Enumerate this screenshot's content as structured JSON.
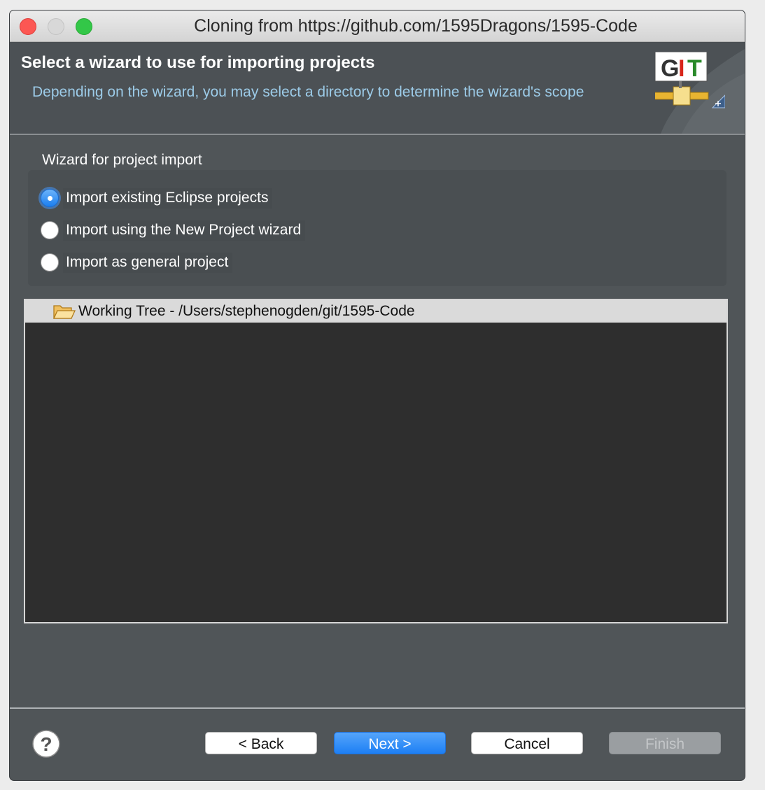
{
  "window": {
    "title": "Cloning from https://github.com/1595Dragons/1595-Code"
  },
  "header": {
    "title": "Select a wizard to use for importing projects",
    "description": "Depending on the wizard, you may select a directory to determine the wizard's scope",
    "logo_text": "GIT"
  },
  "wizard_group": {
    "label": "Wizard for project import",
    "options": [
      {
        "label": "Import existing Eclipse projects",
        "selected": true
      },
      {
        "label": "Import using the New Project wizard",
        "selected": false
      },
      {
        "label": "Import as general project",
        "selected": false
      }
    ]
  },
  "tree": {
    "items": [
      {
        "label": "Working Tree - /Users/stephenogden/git/1595-Code",
        "icon": "folder-open-icon"
      }
    ]
  },
  "buttons": {
    "back": "< Back",
    "next": "Next >",
    "cancel": "Cancel",
    "finish": "Finish"
  },
  "colors": {
    "accent": "#1d7ff4",
    "description_text": "#9ccbe8",
    "dialog_background": "#505558"
  }
}
